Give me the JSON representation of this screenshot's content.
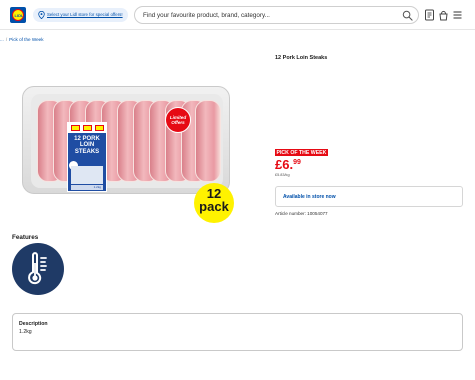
{
  "header": {
    "logo_text": "LIDL",
    "store_link": "Select your Lidl store for special offers!",
    "search_placeholder": "Find your favourite product, brand, category...",
    "icons": [
      "search-icon",
      "receipt-icon",
      "basket-icon",
      "menu-icon"
    ]
  },
  "breadcrumb": {
    "items": [
      "...",
      "Pick of the Week"
    ]
  },
  "product": {
    "title": "12 Pork Loin Steaks",
    "image": {
      "package_label": "12 PORK LOIN STEAKS",
      "package_weight": "1.2kg",
      "badge_limited": "Limited Offers",
      "pack_count": "12",
      "pack_word": "pack"
    },
    "tag": "PICK OF THE WEEK",
    "price_main": "£6.",
    "price_pence": "99",
    "unit_price": "£5.83/kg",
    "availability": "Available in store now",
    "article_number": "Article number: 10054077"
  },
  "features": {
    "title": "Features",
    "icon": "thermometer-icon"
  },
  "description": {
    "title": "Description",
    "value": "1.2kg"
  },
  "colors": {
    "brand_blue": "#0050aa",
    "brand_red": "#e60a14",
    "brand_yellow": "#fff200",
    "feature_navy": "#1f3a66"
  }
}
